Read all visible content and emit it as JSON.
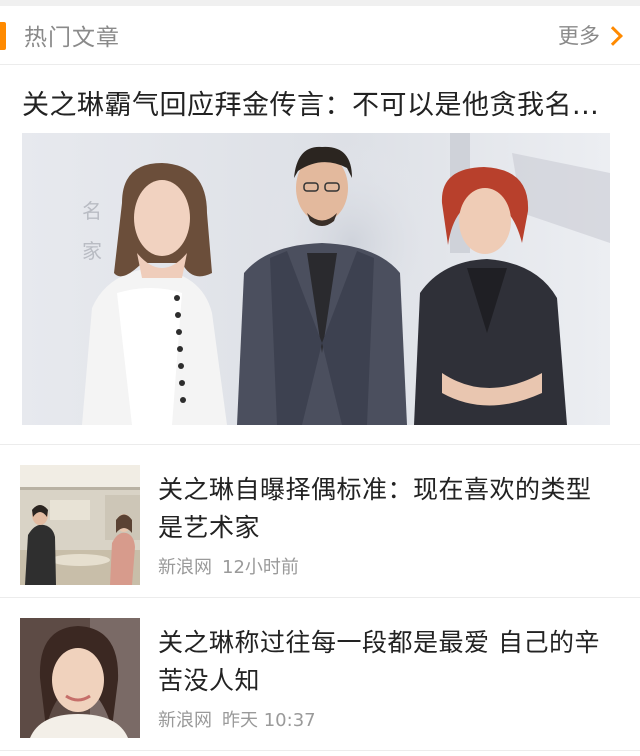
{
  "header": {
    "title": "热门文章",
    "more_label": "更多",
    "accent_color": "#ff8a00",
    "chevron_icon": "chevron-right-icon"
  },
  "featured": {
    "title": "关之琳霸气回应拜金传言：不可以是他贪我名...",
    "image_icon": "three-people-photo"
  },
  "articles": [
    {
      "title": "关之琳自曝择偶标准：现在喜欢的类型是艺术家",
      "source": "新浪网",
      "time": "12小时前",
      "thumb_icon": "interview-photo"
    },
    {
      "title": "关之琳称过往每一段都是最爱 自己的辛苦没人知",
      "source": "新浪网",
      "time": "昨天 10:37",
      "thumb_icon": "portrait-photo"
    }
  ]
}
